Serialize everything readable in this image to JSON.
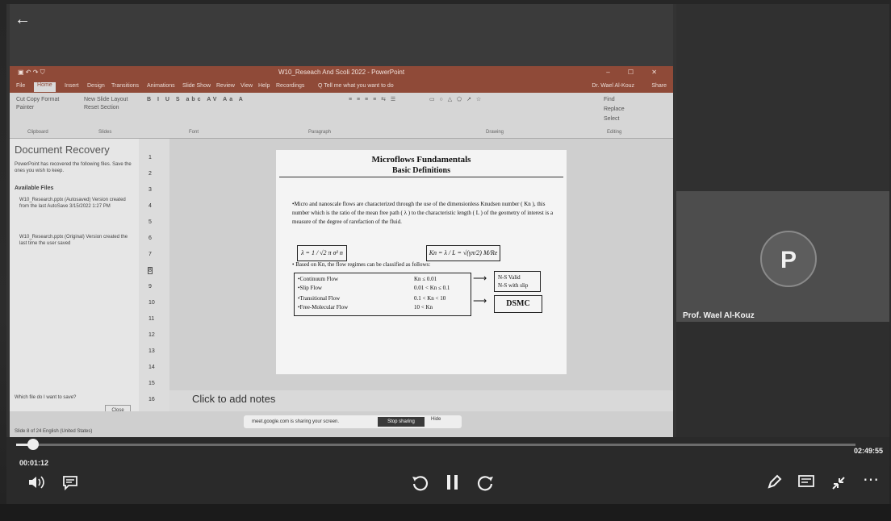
{
  "ppt": {
    "title": "W10_Reseach And Scoli 2022 - PowerPoint",
    "quick_access": "▣ ↶ ↷ ⛉",
    "window_controls": "– ☐ ✕",
    "tabs": [
      "File",
      "Home",
      "Insert",
      "Design",
      "Transitions",
      "Animations",
      "Slide Show",
      "Review",
      "View",
      "Help",
      "Recordings",
      "Q Tell me what you want to do"
    ],
    "user": "Dr. Wael Al-Kouz",
    "share": "Share",
    "ribbon_groups": {
      "clipboard_label": "Clipboard",
      "slides_label": "Slides",
      "font_label": "Font",
      "paragraph_label": "Paragraph",
      "drawing_label": "Drawing",
      "editing_label": "Editing",
      "clip_items": "Cut  Copy  Format Painter",
      "slide_items": "New Slide  Layout  Reset  Section",
      "find": "Find",
      "replace": "Replace",
      "select": "Select"
    },
    "recovery": {
      "heading": "Document Recovery",
      "desc": "PowerPoint has recovered the following files. Save the ones you wish to keep.",
      "available": "Available Files",
      "file1": "W10_Research.pptx (Autosaved) Version created from the last AutoSave 3/15/2022 1:27 PM",
      "file2": "W10_Research.pptx (Original) Version created the last time the user saved",
      "which": "Which file do I want to save?",
      "close": "Close"
    },
    "slide_numbers": [
      "1",
      "2",
      "3",
      "4",
      "5",
      "6",
      "7",
      "8",
      "9",
      "10",
      "11",
      "12",
      "13",
      "14",
      "15",
      "16"
    ],
    "notes_placeholder": "Click to add notes",
    "status_left": "Slide 8 of 24   English (United States)",
    "sharing_text": "meet.google.com is sharing your screen.",
    "stop_sharing": "Stop sharing",
    "hide": "Hide"
  },
  "slide": {
    "title": "Microflows Fundamentals",
    "subtitle": "Basic Definitions",
    "body": "•Micro and nanoscale flows are characterized through the use of the dimensionless Knudsen number ( Kn ), this number which is the ratio of the mean free path ( λ ) to the characteristic length ( L ) of the geometry of interest is a measure of the degree of rarefaction of the fluid.",
    "eq1": "λ = 1 / √2 π σ² n",
    "eq2": "Kn = λ / L = √(γπ/2) M/Re",
    "bullet2": "• Based on Kn, the flow regimes can be classified as follows:",
    "regimes": [
      {
        "name": "•Continuum Flow",
        "range": "Kn ≤ 0.01"
      },
      {
        "name": "•Slip Flow",
        "range": "0.01 < Kn ≤ 0.1"
      },
      {
        "name": "•Transitional Flow",
        "range": "0.1 < Kn < 10"
      },
      {
        "name": "•Free-Molecular Flow",
        "range": "10 < Kn"
      }
    ],
    "ns_valid": "N-S Valid",
    "ns_slip": "N-S with slip",
    "dsmc": "DSMC"
  },
  "meet": {
    "avatar_letter": "P",
    "participant": "Prof. Wael Al-Kouz"
  },
  "player": {
    "current_time": "00:01:12",
    "end_time": "02:49:55",
    "progress": 0.02,
    "back_arrow": "←"
  },
  "icons": [
    "back-arrow-icon",
    "volume-icon",
    "captions-icon",
    "rewind-10-icon",
    "pause-icon",
    "forward-10-icon",
    "pencil-icon",
    "slides-icon",
    "fullscreen-exit-icon",
    "more-icon"
  ]
}
